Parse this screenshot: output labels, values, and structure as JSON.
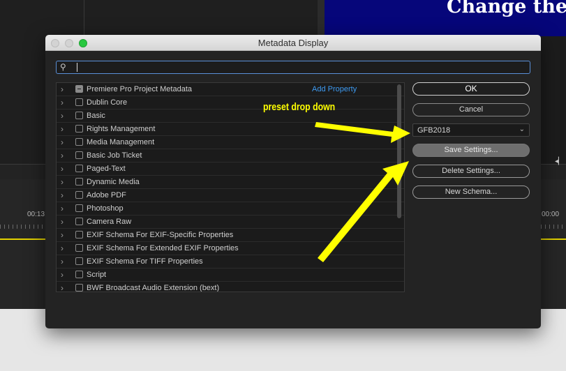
{
  "background": {
    "video_text": "Change the",
    "timecode_left": "00:13",
    "timecode_right": "00:00"
  },
  "dialog": {
    "title": "Metadata Display",
    "search": {
      "value": "",
      "placeholder": ""
    },
    "list": {
      "add_property_label": "Add Property",
      "items": [
        {
          "label": "Premiere Pro Project Metadata",
          "checked": "mixed"
        },
        {
          "label": "Dublin Core",
          "checked": false
        },
        {
          "label": "Basic",
          "checked": false
        },
        {
          "label": "Rights Management",
          "checked": false
        },
        {
          "label": "Media Management",
          "checked": false
        },
        {
          "label": "Basic Job Ticket",
          "checked": false
        },
        {
          "label": "Paged-Text",
          "checked": false
        },
        {
          "label": "Dynamic Media",
          "checked": false
        },
        {
          "label": "Adobe PDF",
          "checked": false
        },
        {
          "label": "Photoshop",
          "checked": false
        },
        {
          "label": "Camera Raw",
          "checked": false
        },
        {
          "label": "EXIF Schema For EXIF-Specific Properties",
          "checked": false
        },
        {
          "label": "EXIF Schema For Extended EXIF Properties",
          "checked": false
        },
        {
          "label": "EXIF Schema For TIFF Properties",
          "checked": false
        },
        {
          "label": "Script",
          "checked": false
        },
        {
          "label": "BWF Broadcast Audio Extension (bext)",
          "checked": false
        }
      ]
    },
    "buttons": {
      "ok": "OK",
      "cancel": "Cancel",
      "save_settings": "Save Settings...",
      "delete_settings": "Delete Settings...",
      "new_schema": "New Schema..."
    },
    "preset": {
      "selected": "GFB2018"
    }
  },
  "annotation": {
    "text": "preset drop down",
    "color": "#ffff00"
  },
  "colors": {
    "link_blue": "#3e9bf2",
    "search_focus": "#5a8fd8",
    "video_blue": "#06067a"
  }
}
